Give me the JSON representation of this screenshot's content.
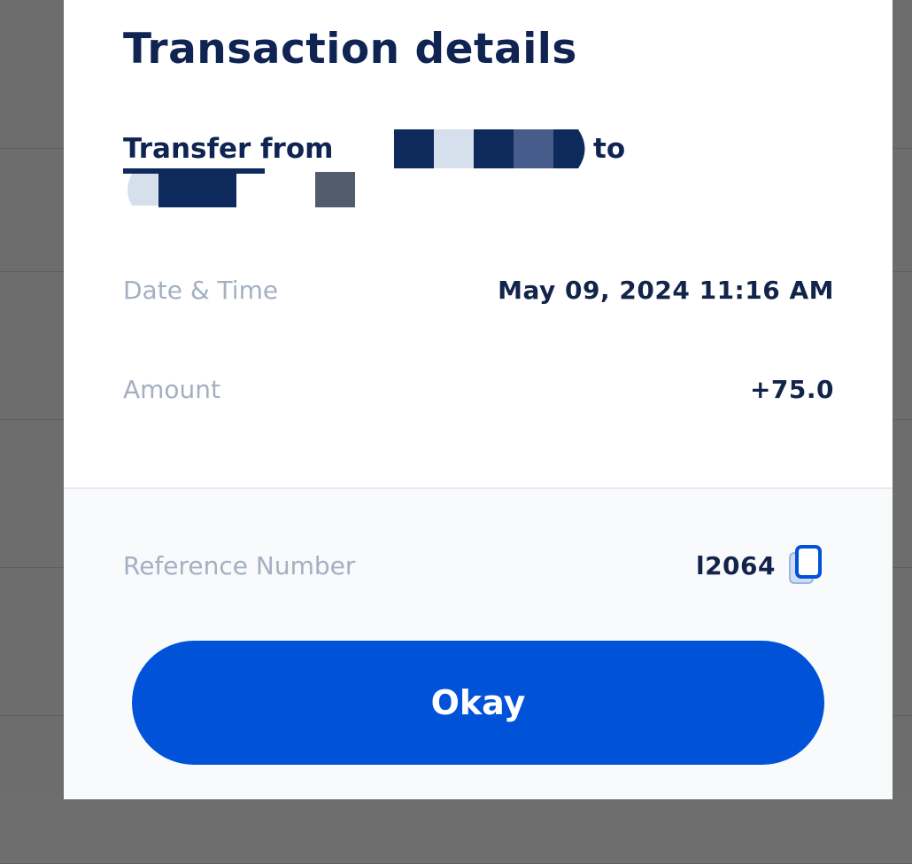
{
  "dialog": {
    "title": "Transaction details",
    "transfer": {
      "prefix": "Transfer from",
      "middle": "to"
    },
    "rows": [
      {
        "label": "Date & Time",
        "value": "May 09, 2024 11:16 AM"
      },
      {
        "label": "Amount",
        "value": "+75.0"
      }
    ],
    "reference": {
      "label": "Reference Number",
      "value": "l2064"
    },
    "okay_label": "Okay"
  },
  "colors": {
    "primary": "#0053d9",
    "title_text": "#0f2452",
    "label_text": "#a4b0c2"
  },
  "icons": {
    "copy": "copy-icon"
  }
}
